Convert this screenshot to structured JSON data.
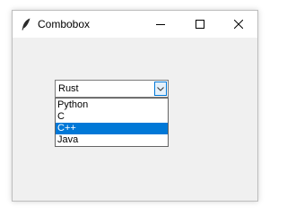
{
  "window": {
    "title": "Combobox",
    "controls": {
      "minimize": "minimize-icon",
      "maximize": "maximize-icon",
      "close": "close-icon"
    }
  },
  "combobox": {
    "value": "Rust",
    "options": [
      "Python",
      "C",
      "C++",
      "Java"
    ],
    "highlighted": "C++"
  },
  "colors": {
    "highlight": "#0078d7",
    "window_bg": "#f0f0f0",
    "titlebar_bg": "#ffffff"
  }
}
